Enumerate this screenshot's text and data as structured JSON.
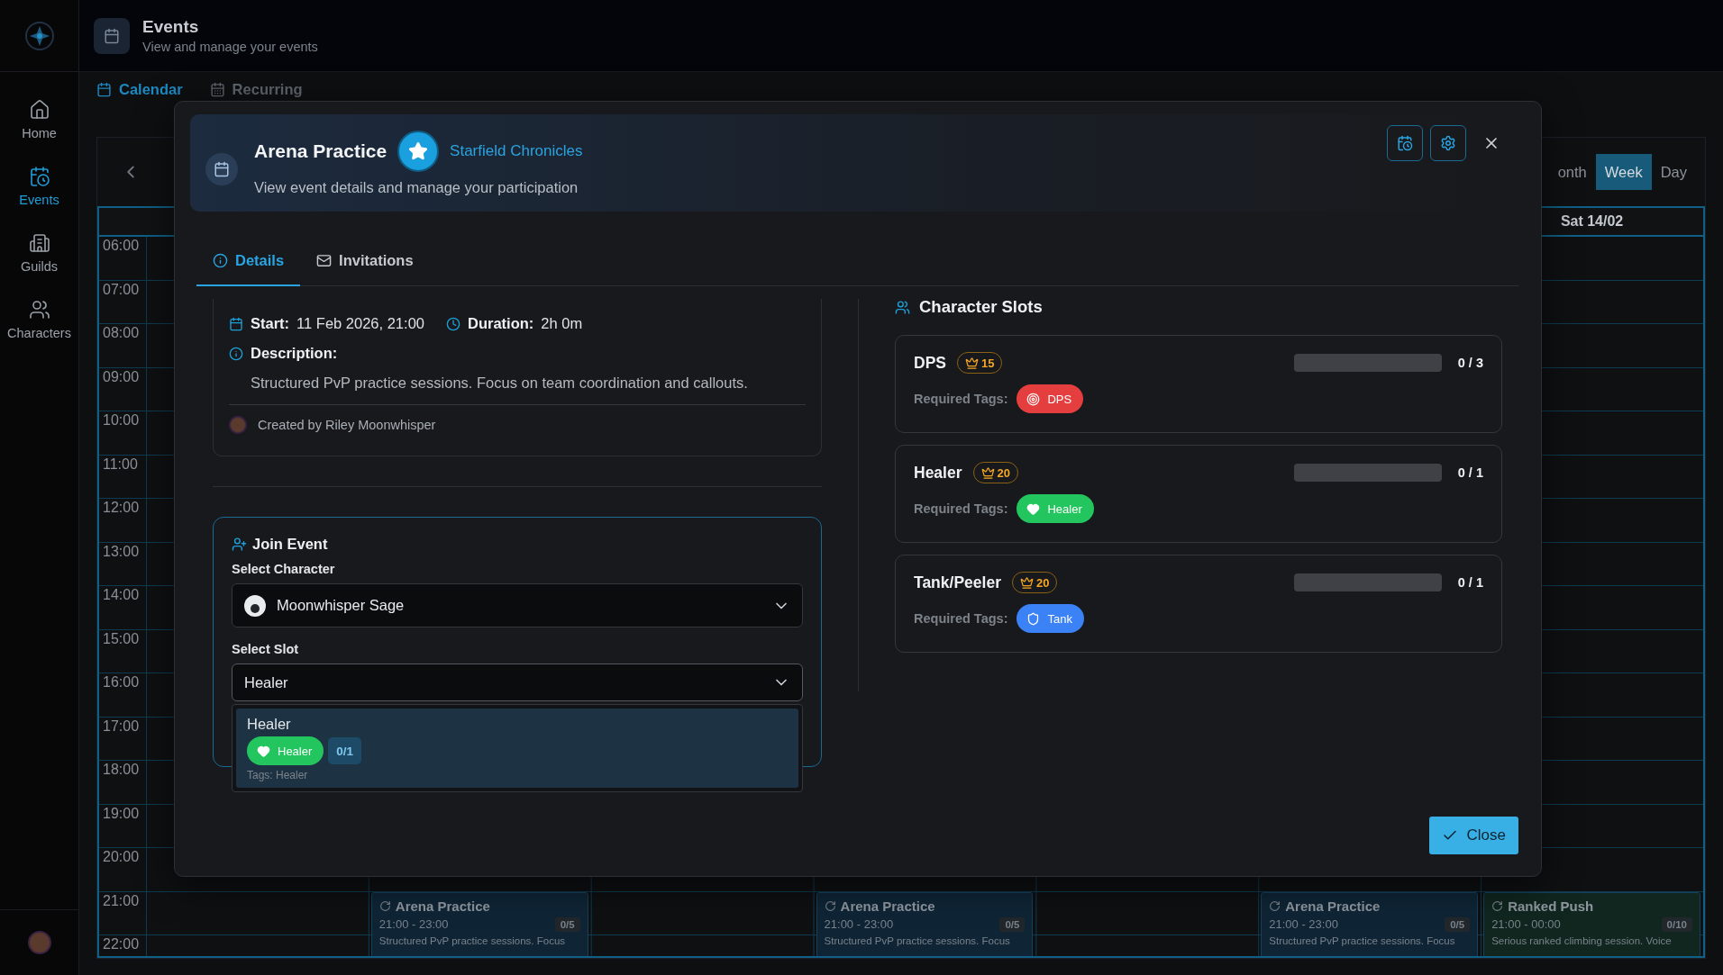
{
  "sidebar": {
    "items": [
      {
        "label": "Home",
        "kind": "home",
        "selected": false
      },
      {
        "label": "Events",
        "kind": "events",
        "selected": true
      },
      {
        "label": "Guilds",
        "kind": "guilds",
        "selected": false
      },
      {
        "label": "Characters",
        "kind": "characters",
        "selected": false
      }
    ]
  },
  "header": {
    "title": "Events",
    "subtitle": "View and manage your events"
  },
  "page_tabs": [
    {
      "label": "Calendar",
      "kind": "calendar",
      "selected": true
    },
    {
      "label": "Recurring",
      "kind": "recurring",
      "selected": false
    }
  ],
  "view_switch": [
    {
      "label": "onth",
      "selected": false
    },
    {
      "label": "Week",
      "selected": true
    },
    {
      "label": "Day",
      "selected": false
    }
  ],
  "calendar": {
    "times": [
      "06:00",
      "07:00",
      "08:00",
      "09:00",
      "10:00",
      "11:00",
      "12:00",
      "13:00",
      "14:00",
      "15:00",
      "16:00",
      "17:00",
      "18:00",
      "19:00",
      "20:00",
      "21:00",
      "22:00"
    ],
    "days": [
      {
        "kind": "blank"
      },
      {
        "kind": "event",
        "event": {
          "title": "Arena Practice",
          "time": "21:00 - 23:00",
          "count": "0/5",
          "description": "Structured PvP practice sessions. Focus",
          "color": "#0f2536"
        }
      },
      {
        "kind": "blank"
      },
      {
        "kind": "event",
        "event": {
          "title": "Arena Practice",
          "time": "21:00 - 23:00",
          "count": "0/5",
          "description": "Structured PvP practice sessions. Focus",
          "color": "#0f2536"
        }
      },
      {
        "kind": "blank"
      },
      {
        "kind": "event",
        "event": {
          "title": "Arena Practice",
          "time": "21:00 - 23:00",
          "count": "0/5",
          "description": "Structured PvP practice sessions. Focus",
          "color": "#0f2536"
        }
      },
      {
        "label": "Sat 14/02",
        "kind": "event",
        "event": {
          "title": "Ranked Push",
          "time": "21:00 - 00:00",
          "count": "0/10",
          "description": "Serious ranked climbing session. Voice",
          "color": "#10261f"
        }
      }
    ]
  },
  "dialog": {
    "title": "Arena Practice",
    "game": "Starfield Chronicles",
    "subtitle": "View event details and manage your participation",
    "tabs": [
      {
        "label": "Details",
        "kind": "info",
        "selected": true
      },
      {
        "label": "Invitations",
        "kind": "mail",
        "selected": false
      }
    ],
    "details": {
      "start_label": "Start:",
      "start": "11 Feb 2026, 21:00",
      "duration_label": "Duration:",
      "duration": "2h 0m",
      "description_label": "Description:",
      "description": "Structured PvP practice sessions. Focus on team coordination and callouts.",
      "created_by": "Created by Riley Moonwhisper"
    },
    "join": {
      "title": "Join Event",
      "character_label": "Select Character",
      "character": "Moonwhisper Sage",
      "slot_label": "Select Slot",
      "slot": "Healer",
      "slot_menu": {
        "expanded": true,
        "options": [
          {
            "name": "Healer",
            "selected": true,
            "tag": {
              "label": "Healer",
              "kind": "heart",
              "color": "#22c55e"
            },
            "count": "0/1",
            "tags_text": "Tags: Healer"
          }
        ]
      }
    },
    "slots_title": "Character Slots",
    "slots": [
      {
        "name": "DPS",
        "points": "15",
        "level": 0,
        "count": "0 / 3",
        "required_label": "Required Tags:",
        "tags": [
          {
            "label": "DPS",
            "kind": "target",
            "color": "#e53e3e"
          }
        ]
      },
      {
        "name": "Healer",
        "points": "20",
        "level": 0,
        "count": "0 / 1",
        "required_label": "Required Tags:",
        "tags": [
          {
            "label": "Healer",
            "kind": "heart",
            "color": "#22c55e"
          }
        ]
      },
      {
        "name": "Tank/Peeler",
        "points": "20",
        "level": 0,
        "count": "0 / 1",
        "required_label": "Required Tags:",
        "tags": [
          {
            "label": "Tank",
            "kind": "shield",
            "color": "#3b82f6"
          }
        ]
      }
    ],
    "close": "Close"
  }
}
